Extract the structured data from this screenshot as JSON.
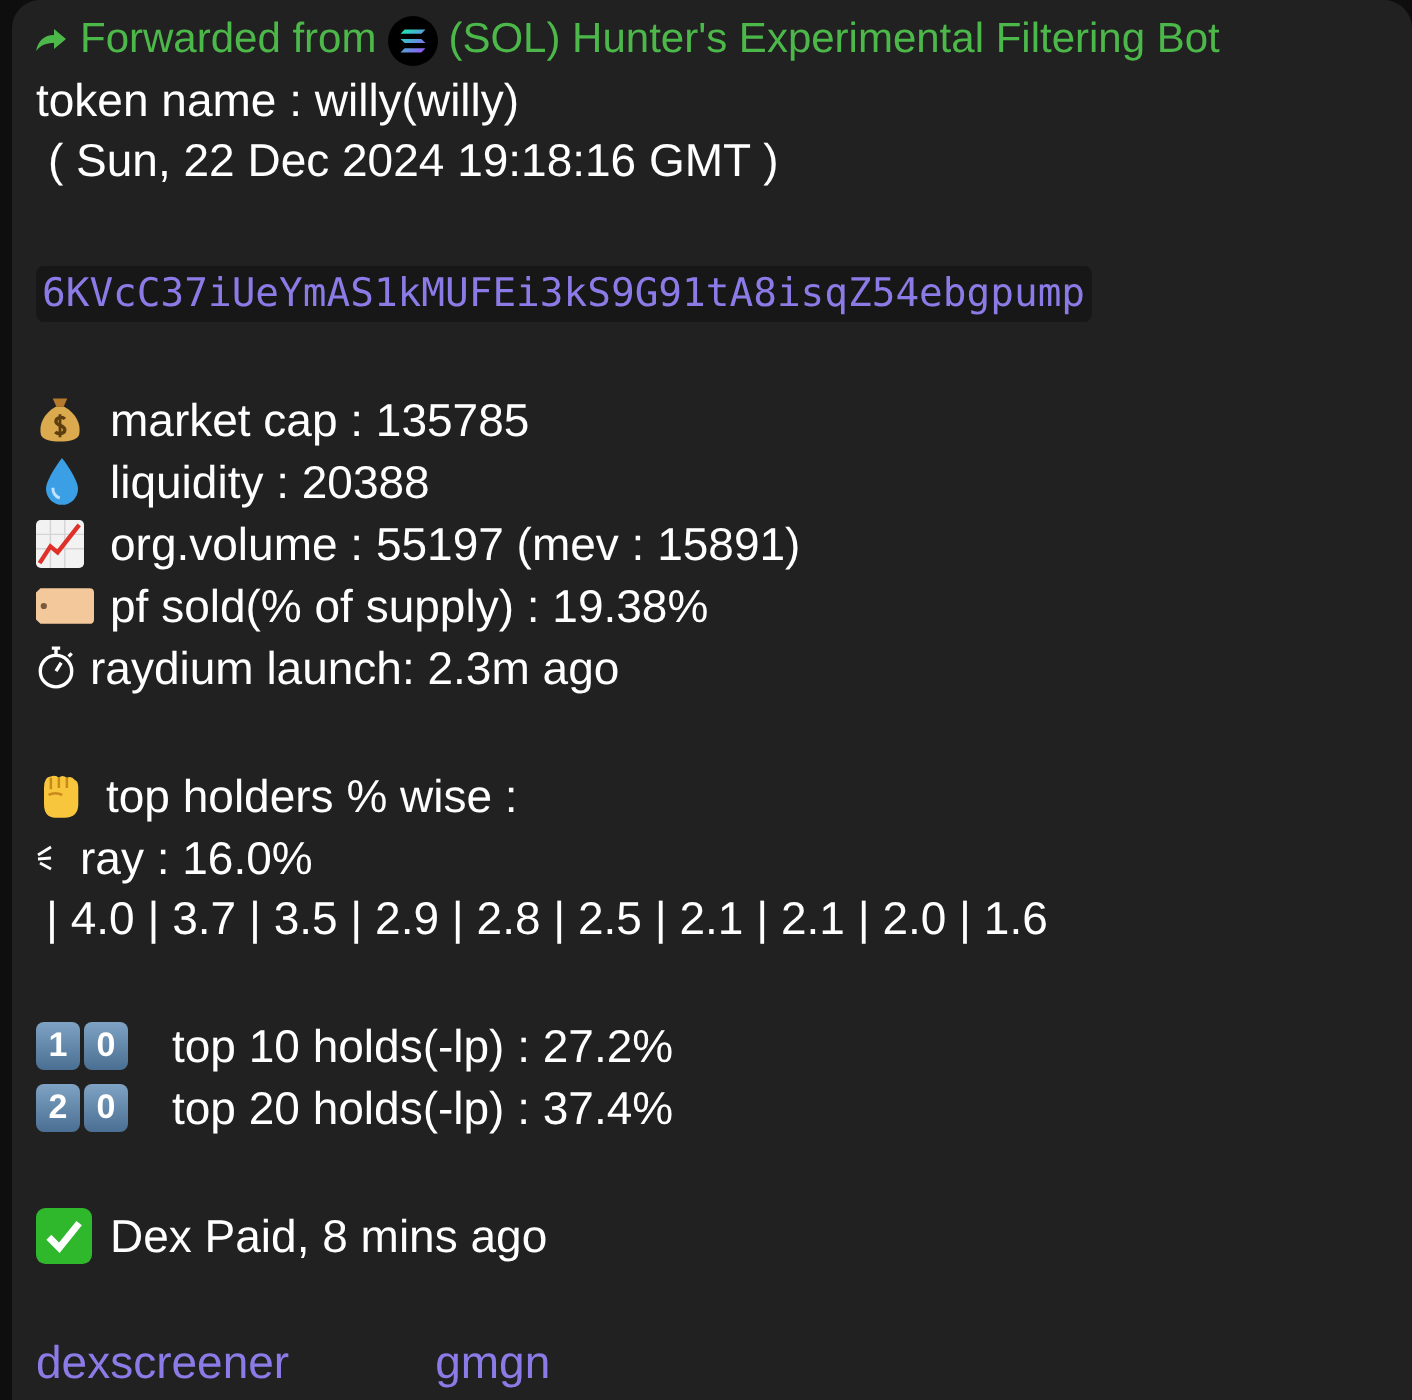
{
  "forwarded": {
    "label": "Forwarded from",
    "source": "(SOL) Hunter's Experimental Filtering Bot"
  },
  "token": {
    "name_line": "token name : willy(willy)",
    "date_line": "( Sun, 22 Dec 2024 19:18:16 GMT )",
    "address": "6KVcC37iUeYmAS1kMUFEi3kS9G91tA8isqZ54ebgpump"
  },
  "stats": [
    {
      "kind": "money-bag",
      "text": "market cap : 135785"
    },
    {
      "kind": "droplet",
      "text": "liquidity : 20388"
    },
    {
      "kind": "chart",
      "text": "org.volume : 55197 (mev : 15891)"
    },
    {
      "kind": "tag",
      "text": "pf sold(% of supply) : 19.38%"
    },
    {
      "kind": "stopwatch",
      "text": "raydium launch: 2.3m ago"
    }
  ],
  "holders": {
    "heading": {
      "kind": "fist",
      "text": "top holders % wise :"
    },
    "lp": {
      "kind": "lines",
      "text": "ray : 16.0%"
    },
    "distribution": "| 4.0 | 3.7 | 3.5 | 2.9 | 2.8 | 2.5 | 2.1 | 2.1 | 2.0 | 1.6"
  },
  "top_holds": [
    {
      "keycaps": [
        "1",
        "0"
      ],
      "text": "top 10 holds(-lp) : 27.2%"
    },
    {
      "keycaps": [
        "2",
        "0"
      ],
      "text": "top 20 holds(-lp) : 37.4%"
    }
  ],
  "dex": {
    "kind": "check",
    "text": "Dex Paid, 8 mins ago"
  },
  "links": [
    "dexscreener",
    "gmgn"
  ]
}
